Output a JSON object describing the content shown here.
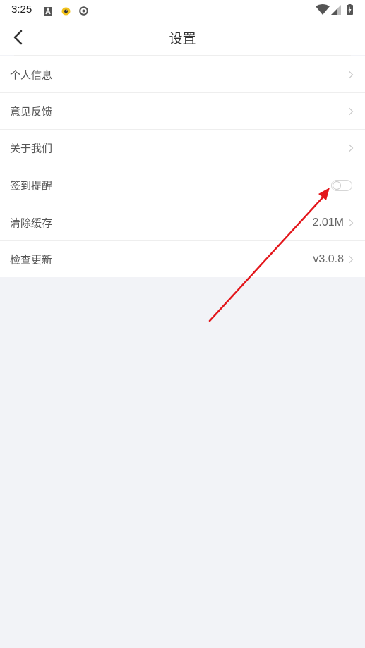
{
  "status_bar": {
    "time": "3:25",
    "icons_left": [
      "a-notification-icon",
      "app-notification-icon",
      "media-notification-icon"
    ],
    "icons_right": [
      "wifi-icon",
      "signal-icon",
      "battery-icon"
    ]
  },
  "header": {
    "title": "设置",
    "back_icon": "back-arrow-icon"
  },
  "settings": {
    "items": [
      {
        "label": "个人信息",
        "value": "",
        "control": "chevron"
      },
      {
        "label": "意见反馈",
        "value": "",
        "control": "chevron"
      },
      {
        "label": "关于我们",
        "value": "",
        "control": "chevron"
      },
      {
        "label": "签到提醒",
        "value": "",
        "control": "toggle",
        "toggle_on": false
      },
      {
        "label": "清除缓存",
        "value": "2.01M",
        "control": "chevron"
      },
      {
        "label": "检查更新",
        "value": "v3.0.8",
        "control": "chevron"
      }
    ]
  },
  "colors": {
    "page_background": "#f2f3f7",
    "surface": "#ffffff",
    "label_text": "#555555",
    "annotation_arrow": "#e3161b"
  }
}
